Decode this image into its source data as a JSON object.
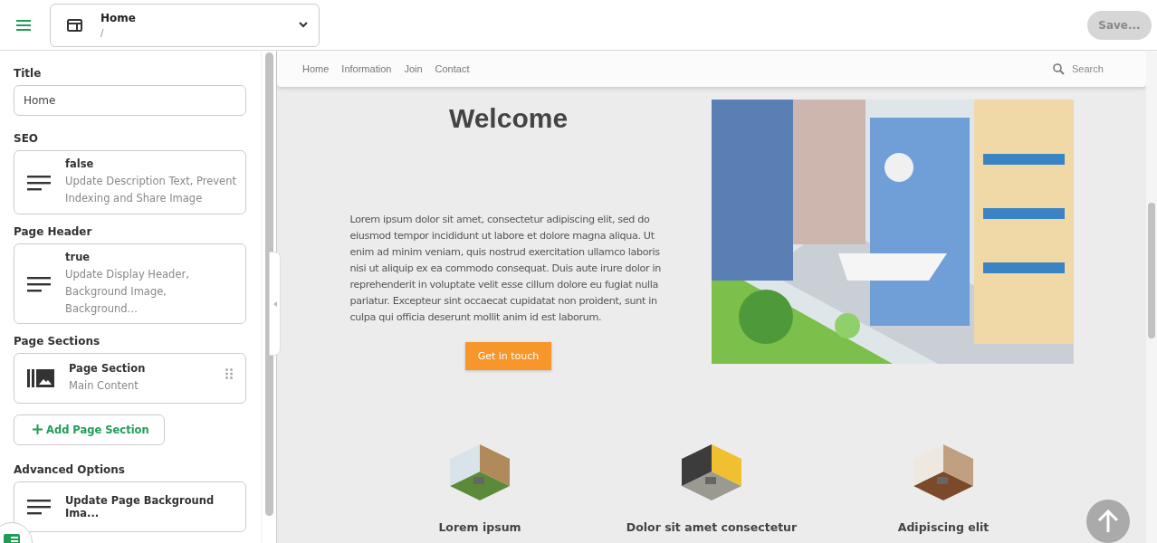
{
  "topbar": {
    "page_title": "Home",
    "page_path": "/",
    "save_button": {
      "label": "Save...",
      "disabled": true
    }
  },
  "sidebar": {
    "sections": [
      {
        "kind": "field",
        "label": "Title",
        "value": "Home"
      },
      {
        "kind": "summary",
        "label": "SEO",
        "value": "false",
        "description": "Update Description Text, Prevent Indexing and Share Image"
      },
      {
        "kind": "summary",
        "label": "Page Header",
        "value": "true",
        "description": "Update Display Header, Background Image, Background…"
      },
      {
        "kind": "list",
        "label": "Page Sections",
        "items": [
          {
            "title": "Page Section",
            "subtitle": "Main Content"
          }
        ],
        "add_button": "Add Page Section"
      },
      {
        "kind": "summary",
        "label": "Advanced Options",
        "value": "Update Page Background Ima..."
      }
    ]
  },
  "preview": {
    "nav": [
      "Home",
      "Information",
      "Join",
      "Contact"
    ],
    "search_placeholder": "Search",
    "hero": {
      "title": "Welcome",
      "text": "Lorem ipsum dolor sit amet, consectetur adipiscing elit, sed do eiusmod tempor incididunt ut labore et dolore magna aliqua. Ut enim ad minim veniam, quis nostrud exercitation ullamco laboris nisi ut aliquip ex ea commodo consequat. Duis aute irure dolor in reprehenderit in voluptate velit esse cillum dolore eu fugiat nulla pariatur. Excepteur sint occaecat cupidatat non proident, sunt in culpa qui officia deserunt mollit anim id est laborum.",
      "button": "Get in touch"
    },
    "features": [
      {
        "title": "Lorem ipsum",
        "kind": "office"
      },
      {
        "title": "Dolor sit amet consectetur",
        "kind": "factory"
      },
      {
        "title": "Adipiscing elit",
        "kind": "gallery"
      }
    ]
  }
}
